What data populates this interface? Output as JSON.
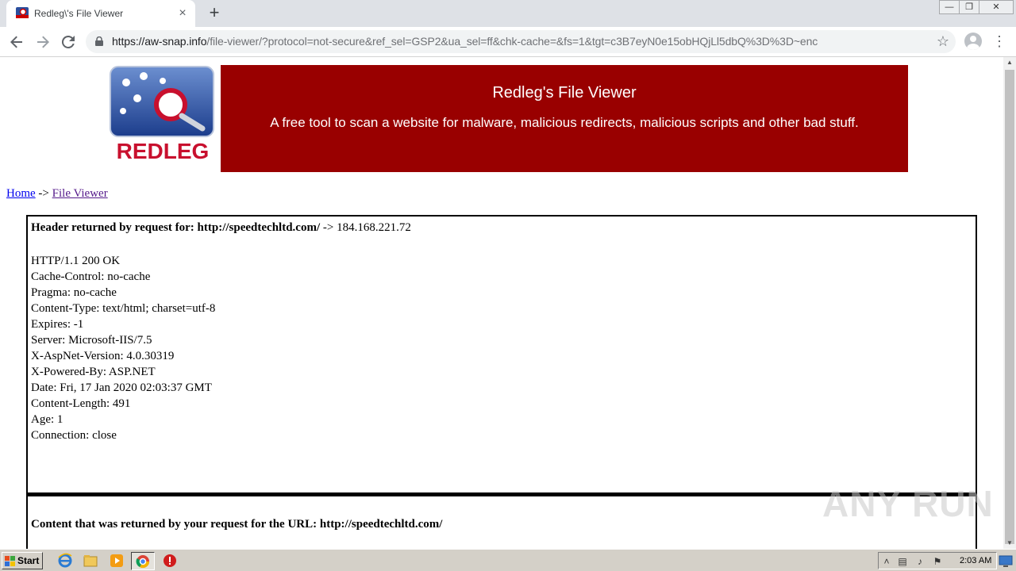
{
  "browser": {
    "tab_title": "Redleg\\'s File Viewer",
    "tab_close": "×",
    "new_tab": "+",
    "url_host": "https://aw-snap.info",
    "url_rest": "/file-viewer/?protocol=not-secure&ref_sel=GSP2&ua_sel=ff&chk-cache=&fs=1&tgt=c3B7eyN0e15obHQjLl5dbQ%3D%3D~enc",
    "icons": [
      "back-arrow-icon",
      "forward-arrow-icon",
      "reload-icon",
      "lock-icon",
      "star-icon",
      "profile-icon",
      "menu-icon"
    ]
  },
  "page": {
    "banner_title": "Redleg's File Viewer",
    "banner_subtitle": "A free tool to scan a website for malware, malicious redirects, malicious scripts and other bad stuff.",
    "logo_text": "REDLEG",
    "breadcrumb": {
      "home": "Home",
      "separator": "->",
      "current": "File Viewer"
    },
    "header_label": "Header returned by request for: http://speedtechltd.com/",
    "header_ip": "-> 184.168.221.72",
    "header_lines": [
      "HTTP/1.1 200 OK",
      "Cache-Control: no-cache",
      "Pragma: no-cache",
      "Content-Type: text/html; charset=utf-8",
      "Expires: -1",
      "Server: Microsoft-IIS/7.5",
      "X-AspNet-Version: 4.0.30319",
      "X-Powered-By: ASP.NET",
      "Date: Fri, 17 Jan 2020 02:03:37 GMT",
      "Content-Length: 491",
      "Age: 1",
      "Connection: close"
    ],
    "content_label": "Content that was returned by your request for the URL: http://speedtechltd.com/",
    "watermark": "ANY RUN"
  },
  "taskbar": {
    "start_label": "Start",
    "clock": "2:03 AM",
    "colors": {
      "banner": "#990000",
      "link": "#0000ee",
      "visited": "#551a8b"
    }
  }
}
